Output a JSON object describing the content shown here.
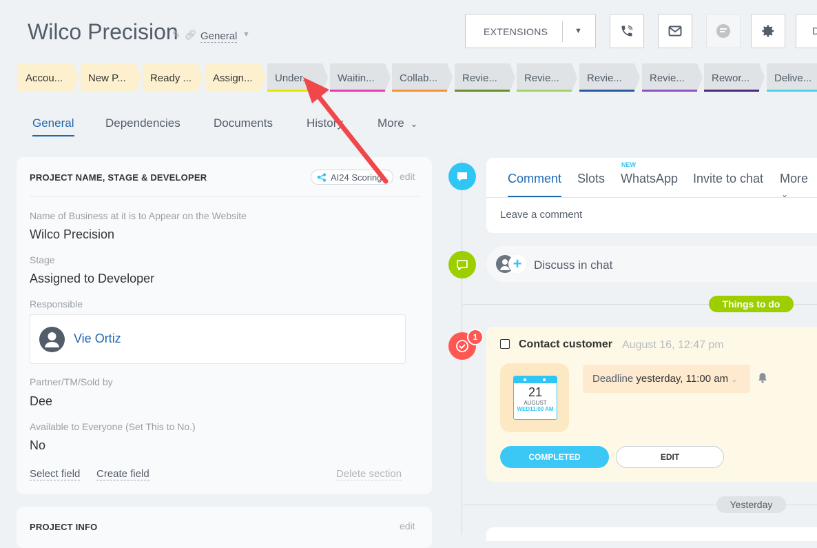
{
  "header": {
    "title": "Wilco Precision",
    "category": "General",
    "extensions_label": "EXTENSIONS",
    "right_button_partial": "D"
  },
  "stages": [
    {
      "label": "Accou...",
      "state": "done",
      "color": "#fdf0cf"
    },
    {
      "label": "New P...",
      "state": "done",
      "color": "#fdf0cf"
    },
    {
      "label": "Ready ...",
      "state": "done",
      "color": "#fdf0cf"
    },
    {
      "label": "Assign...",
      "state": "done",
      "color": "#fdf0cf"
    },
    {
      "label": "Under...",
      "state": "todo",
      "underline": "#e4e800"
    },
    {
      "label": "Waitin...",
      "state": "todo",
      "underline": "#e73cb0"
    },
    {
      "label": "Collab...",
      "state": "todo",
      "underline": "#f59234"
    },
    {
      "label": "Revie...",
      "state": "todo",
      "underline": "#6a8f2a"
    },
    {
      "label": "Revie...",
      "state": "todo",
      "underline": "#a4d36b"
    },
    {
      "label": "Revie...",
      "state": "todo",
      "underline": "#2a5aa0"
    },
    {
      "label": "Revie...",
      "state": "todo",
      "underline": "#8e54c4"
    },
    {
      "label": "Rewor...",
      "state": "todo",
      "underline": "#4b2a7a"
    },
    {
      "label": "Delive...",
      "state": "todo",
      "underline": "#4fd0e8"
    }
  ],
  "tabs": {
    "general": "General",
    "dependencies": "Dependencies",
    "documents": "Documents",
    "history": "History",
    "more": "More"
  },
  "project_card": {
    "title": "PROJECT NAME, STAGE & DEVELOPER",
    "ai_badge": "AI24 Scoring",
    "edit": "edit",
    "fields": [
      {
        "label": "Name of Business at it is to Appear on the Website",
        "value": "Wilco Precision"
      },
      {
        "label": "Stage",
        "value": "Assigned to Developer"
      },
      {
        "label": "Responsible",
        "value": "Vie Ortiz"
      },
      {
        "label": "Partner/TM/Sold by",
        "value": "Dee"
      },
      {
        "label": "Available to Everyone (Set This to No.)",
        "value": "No"
      }
    ],
    "select_field": "Select field",
    "create_field": "Create field",
    "delete_section": "Delete section"
  },
  "project_info_card": {
    "title": "PROJECT INFO",
    "edit": "edit"
  },
  "comment_tabs": {
    "comment": "Comment",
    "slots": "Slots",
    "whatsapp": "WhatsApp",
    "whatsapp_badge": "NEW",
    "invite": "Invite to chat",
    "more": "More"
  },
  "comment_placeholder": "Leave a comment",
  "discuss": "Discuss in chat",
  "things_to_do": "Things to do",
  "todo": {
    "badge_count": "1",
    "title": "Contact customer",
    "date": "August 16, 12:47 pm",
    "calendar": {
      "day": "21",
      "month": "AUGUST",
      "weekday_time": "WED11:00 AM"
    },
    "deadline_label": "Deadline",
    "deadline_value": "yesterday, 11:00 am",
    "completed": "COMPLETED",
    "edit": "EDIT"
  },
  "yesterday": "Yesterday",
  "colors": {
    "accent": "#2067b0",
    "timeline_blue": "#2fc6f6",
    "timeline_green": "#9dcf00",
    "timeline_red": "#ff5752",
    "arrow": "#f0474b"
  },
  "icons": [
    "pencil-icon",
    "link-icon",
    "phone-icon",
    "mail-icon",
    "chat-bubble-icon",
    "gear-icon",
    "ai-network-icon",
    "user-icon",
    "comment-icon",
    "chat-icon",
    "check-icon",
    "bell-icon",
    "calendar-icon",
    "chevron-down-icon",
    "arrow-annotation"
  ]
}
